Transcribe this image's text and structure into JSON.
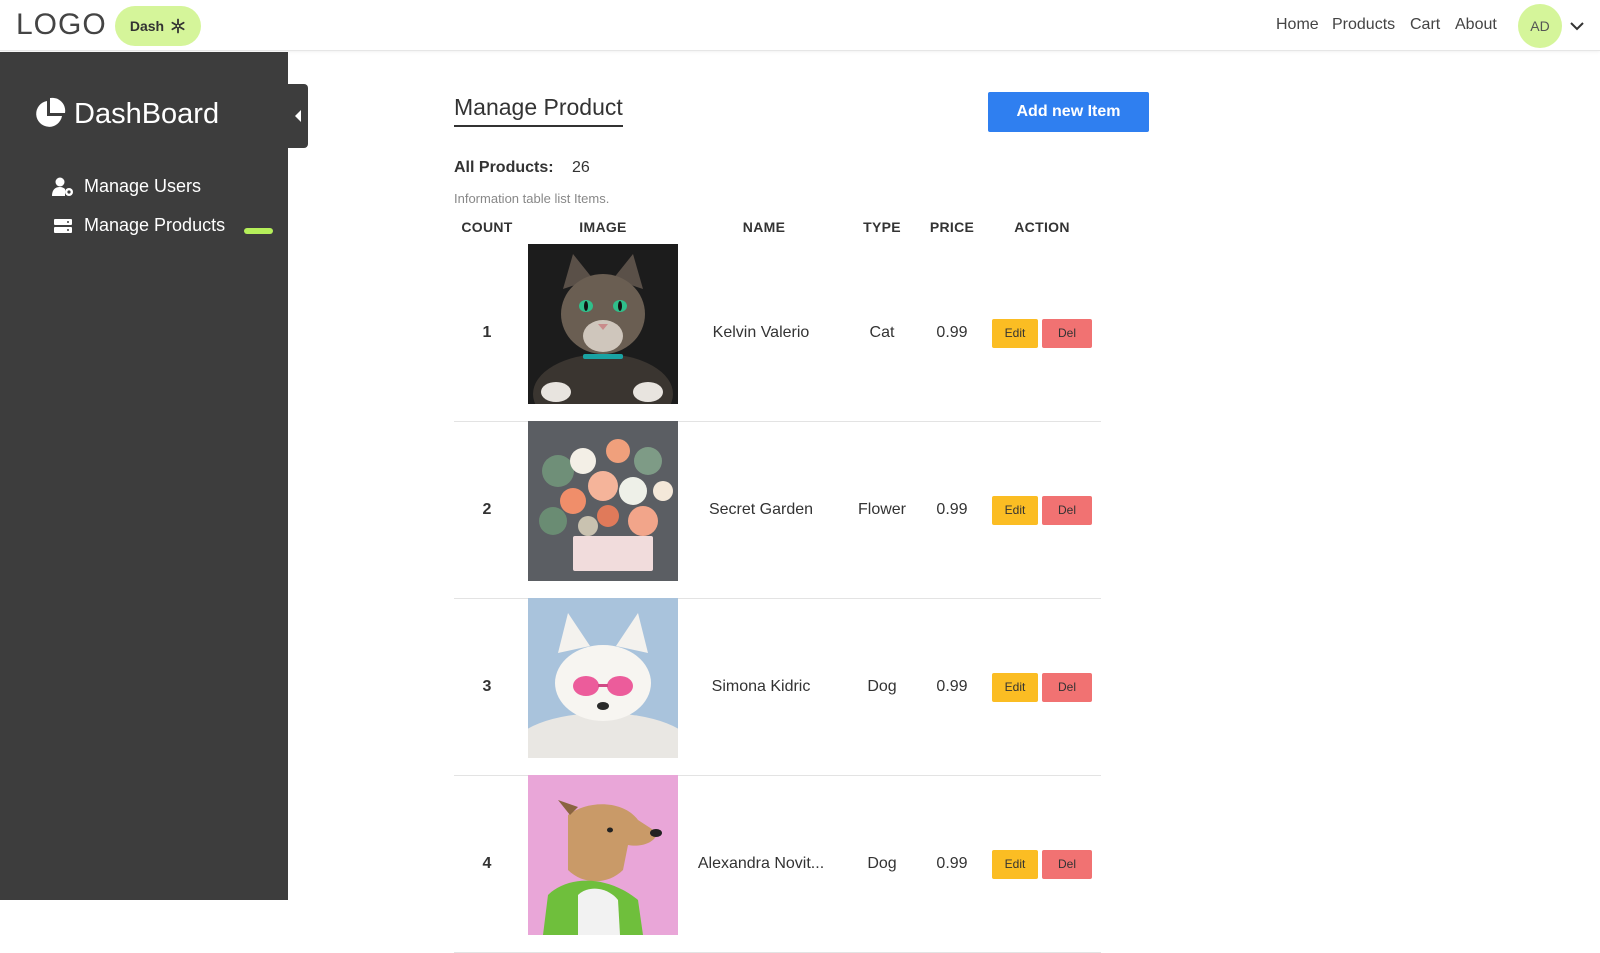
{
  "header": {
    "logo": "LOGO",
    "dash_pill": "Dash",
    "nav": [
      "Home",
      "Products",
      "Cart",
      "About"
    ],
    "avatar": "AD"
  },
  "sidebar": {
    "title": "DashBoard",
    "items": [
      {
        "label": "Manage Users",
        "icon": "user-gear-icon"
      },
      {
        "label": "Manage Products",
        "icon": "server-icon",
        "active": true
      }
    ]
  },
  "main": {
    "title": "Manage Product",
    "add_button": "Add new Item",
    "all_products_label": "All Products:",
    "all_products_count": "26",
    "info_text": "Information table list Items.",
    "columns": [
      "COUNT",
      "IMAGE",
      "NAME",
      "TYPE",
      "PRICE",
      "ACTION"
    ],
    "edit_label": "Edit",
    "del_label": "Del",
    "rows": [
      {
        "count": "1",
        "name": "Kelvin Valerio",
        "type": "Cat",
        "price": "0.99",
        "image": "cat-photo"
      },
      {
        "count": "2",
        "name": "Secret Garden",
        "type": "Flower",
        "price": "0.99",
        "image": "flower-bouquet-photo"
      },
      {
        "count": "3",
        "name": "Simona Kidric",
        "type": "Dog",
        "price": "0.99",
        "image": "white-dog-photo"
      },
      {
        "count": "4",
        "name": "Alexandra Novit...",
        "type": "Dog",
        "price": "0.99",
        "image": "dog-pink-background-photo"
      }
    ]
  },
  "colors": {
    "sidebar_bg": "#3d3d3d",
    "accent_green": "#d5f59a",
    "active_indicator": "#b5ef5a",
    "primary_button": "#2f7ff0",
    "edit_button": "#fbbd23",
    "del_button": "#f17272"
  }
}
